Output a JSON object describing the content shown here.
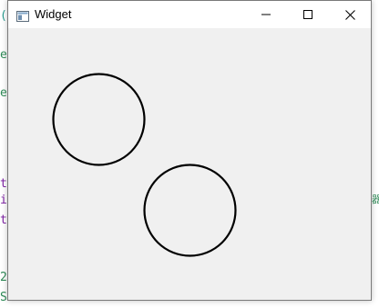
{
  "window": {
    "title": "Widget",
    "icon": "qt-window-icon",
    "controls": {
      "minimize": "minimize-icon",
      "maximize": "maximize-icon",
      "close": "close-icon"
    }
  },
  "background_code": {
    "left_fragments": [
      {
        "text": "(",
        "color": "#2a9d8f"
      },
      {
        "text": "e",
        "color": "#2e8b57"
      },
      {
        "text": "e",
        "color": "#2e8b57"
      },
      {
        "text": "t",
        "color": "#7b1fa2"
      },
      {
        "text": "i",
        "color": "#7b1fa2"
      },
      {
        "text": "t",
        "color": "#7b1fa2"
      },
      {
        "text": "2",
        "color": "#2e8b57"
      },
      {
        "text": "S",
        "color": "#2e8b57"
      }
    ],
    "right_fragments": [
      {
        "text": "器",
        "color": "#2e8b57"
      }
    ]
  },
  "canvas": {
    "background": "#f0f0f0",
    "stroke": "#000000",
    "circles": [
      {
        "name": "circle-1"
      },
      {
        "name": "circle-2"
      }
    ]
  }
}
